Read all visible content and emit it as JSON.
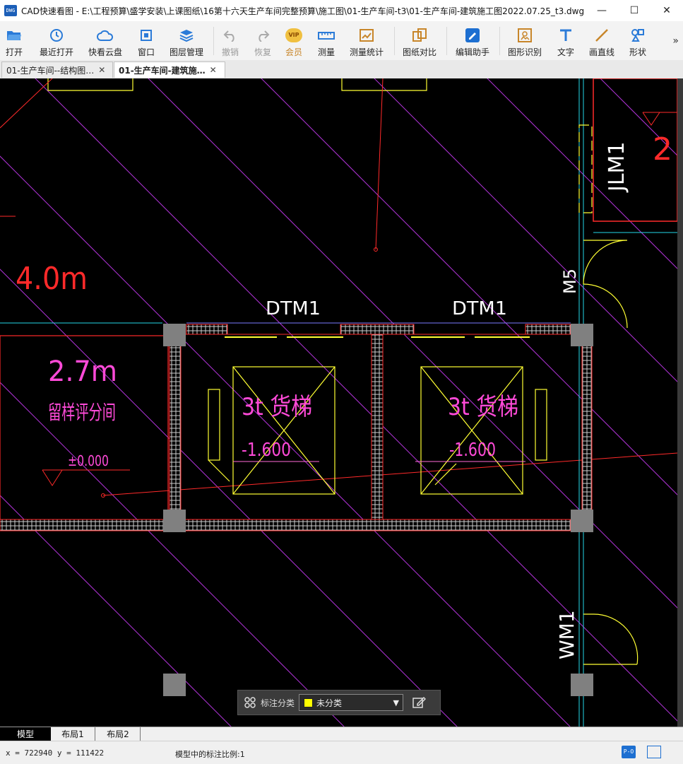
{
  "window": {
    "app_logo": "DWG",
    "title": "CAD快速看图 - E:\\工程预算\\盛学安装\\上课图纸\\16第十六天生产车间完整预算\\施工图\\01-生产车间-t3\\01-生产车间-建筑施工图2022.07.25_t3.dwg",
    "minimize": "—",
    "maximize": "☐",
    "close": "✕"
  },
  "toolbar": {
    "items": [
      {
        "label": "打开",
        "icon": "folder-open-icon"
      },
      {
        "label": "最近打开",
        "icon": "recent-clock-icon"
      },
      {
        "label": "快看云盘",
        "icon": "cloud-icon"
      },
      {
        "label": "窗口",
        "icon": "window-icon"
      },
      {
        "label": "图层管理",
        "icon": "layers-icon"
      },
      {
        "label": "撤销",
        "icon": "undo-icon"
      },
      {
        "label": "恢复",
        "icon": "redo-icon"
      },
      {
        "label": "会员",
        "icon": "vip-icon"
      },
      {
        "label": "测量",
        "icon": "ruler-icon"
      },
      {
        "label": "测量统计",
        "icon": "measure-stats-icon"
      },
      {
        "label": "图纸对比",
        "icon": "compare-icon"
      },
      {
        "label": "编辑助手",
        "icon": "edit-assistant-icon"
      },
      {
        "label": "图形识别",
        "icon": "shape-recognize-icon"
      },
      {
        "label": "文字",
        "icon": "text-icon"
      },
      {
        "label": "画直线",
        "icon": "line-icon"
      },
      {
        "label": "形状",
        "icon": "shapes-icon"
      }
    ],
    "more": "»",
    "vip_text": "VIP"
  },
  "tabs": [
    {
      "label": "01-生产车间--结构图…",
      "close": "✕",
      "active": false
    },
    {
      "label": "01-生产车间-建筑施…",
      "close": "✕",
      "active": true
    }
  ],
  "drawing": {
    "texts": {
      "dtm1_left": "DTM1",
      "dtm1_right": "DTM1",
      "m5": "M5",
      "jlm1": "JLM1",
      "num_2": "2",
      "wm1": "WM1",
      "height_4": "4.0m",
      "height_27": "2.7m",
      "room_name": "留样评分间",
      "level_zero": "±0.000",
      "elevator_left": "3t 货梯",
      "elevator_right": "3t 货梯",
      "pit_left": "-1.600",
      "pit_right": "-1.600"
    }
  },
  "annotation_bar": {
    "label": "标注分类",
    "selected": "未分类",
    "swatch_color": "#ffff00",
    "caret": "▼"
  },
  "layouts": [
    {
      "label": "模型",
      "active": true
    },
    {
      "label": "布局1",
      "active": false
    },
    {
      "label": "布局2",
      "active": false
    }
  ],
  "status": {
    "coordinates": "x = 722940  y = 111422",
    "scale": "模型中的标注比例:1",
    "icon1": "P-O"
  },
  "colors": {
    "canvas": "#000000",
    "hatch": "#b034d8",
    "wall": "#ff2a2a",
    "equipment": "#ffff33",
    "text_pink": "#e34fd6",
    "cyan": "#25d8e8",
    "column": "#808080",
    "white_text": "#ffffff"
  }
}
